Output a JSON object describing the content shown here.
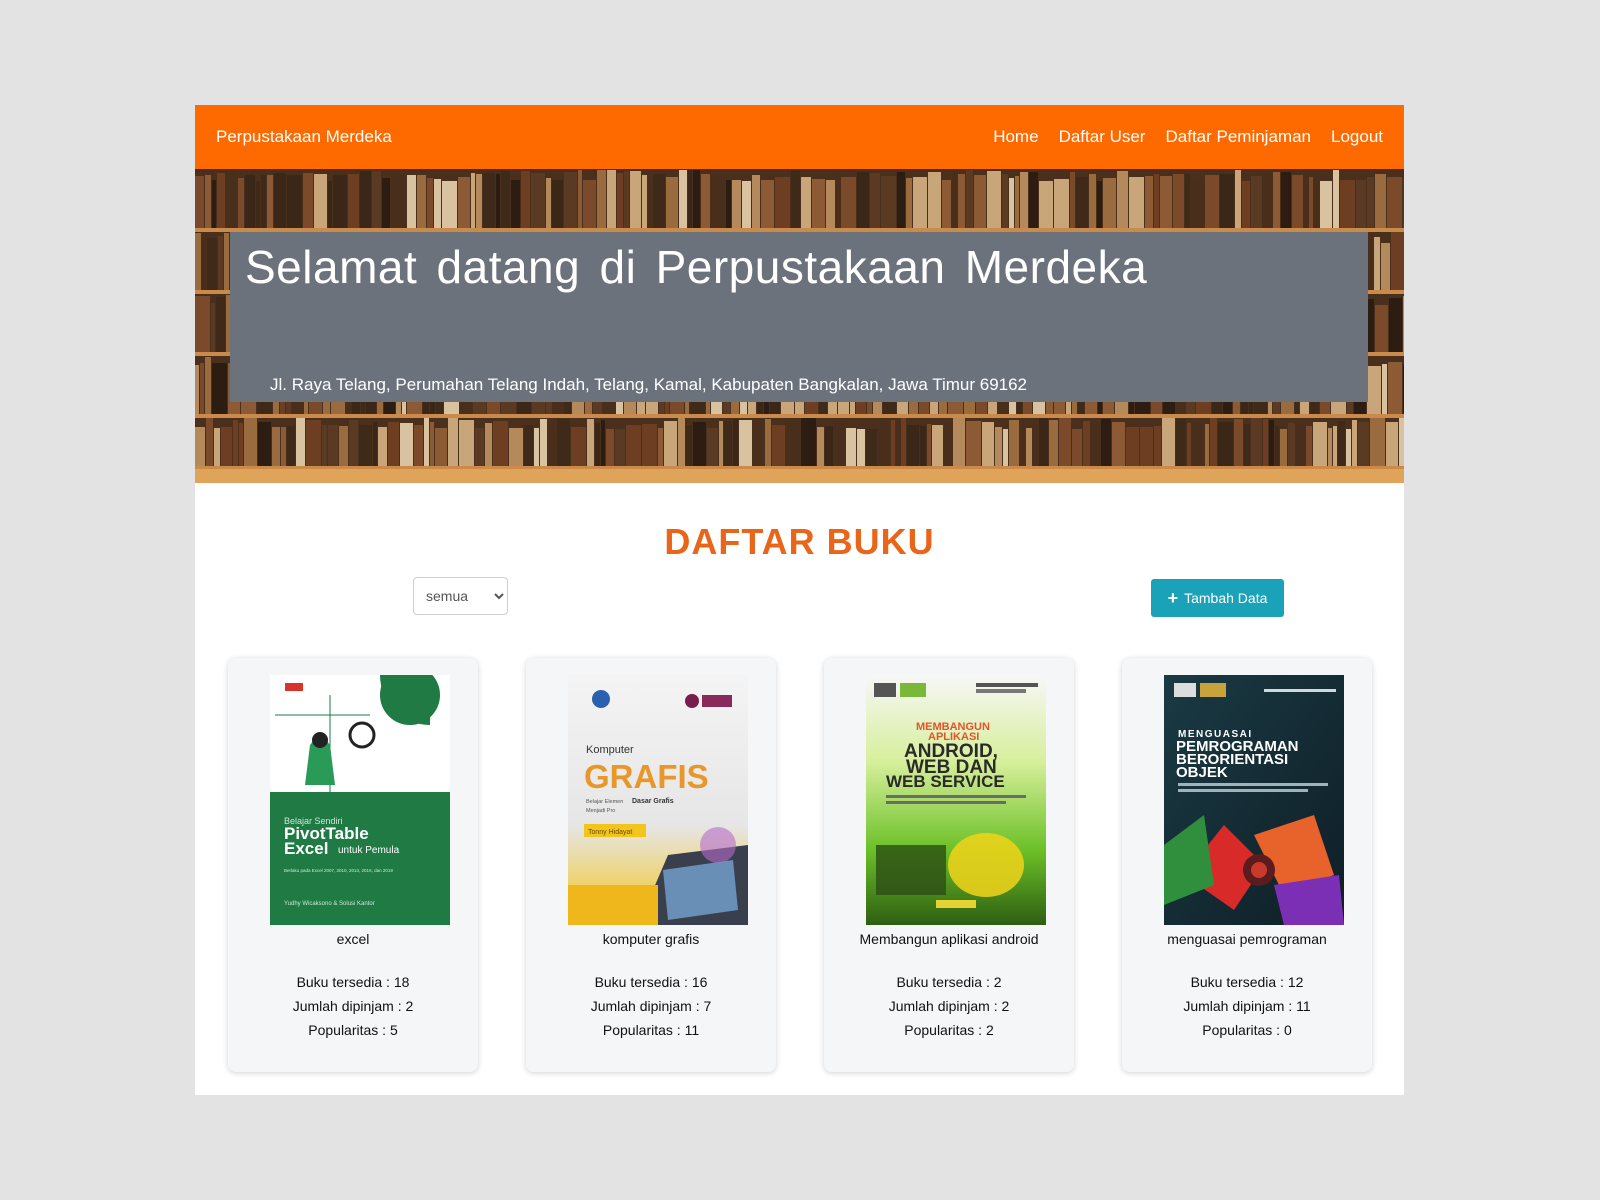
{
  "navbar": {
    "brand": "Perpustakaan Merdeka",
    "links": [
      "Home",
      "Daftar User",
      "Daftar Peminjaman",
      "Logout"
    ]
  },
  "hero": {
    "title": "Selamat datang di Perpustakaan Merdeka",
    "address": "Jl. Raya Telang, Perumahan Telang Indah, Telang, Kamal, Kabupaten Bangkalan, Jawa Timur 69162"
  },
  "main": {
    "title": "DAFTAR BUKU",
    "filter": {
      "selected": "semua"
    },
    "add_button": "Tambah Data"
  },
  "books": [
    {
      "title": "excel",
      "available": "Buku tersedia : 18",
      "borrowed": "Jumlah dipinjam : 2",
      "popularity": "Popularitas : 5",
      "cover": {
        "line1": "Belajar Sendiri",
        "line2": "PivotTable",
        "line3": "Excel",
        "line3b": "untuk Pemula",
        "line4": "Berlaku pada Excel 2007, 2010, 2013, 2016, dan 2019",
        "author": "Yudhy Wicaksono & Solusi Kantor"
      }
    },
    {
      "title": "komputer grafis",
      "available": "Buku tersedia : 16",
      "borrowed": "Jumlah dipinjam : 7",
      "popularity": "Popularitas : 11",
      "cover": {
        "line1": "Komputer",
        "line2": "GRAFIS",
        "line3": "Belajar Elemen",
        "line3b": "Dasar Grafis",
        "line4": "Menjadi Pro",
        "author": "Tonny Hidayat"
      }
    },
    {
      "title": "Membangun aplikasi android",
      "available": "Buku tersedia : 2",
      "borrowed": "Jumlah dipinjam : 2",
      "popularity": "Popularitas : 2",
      "cover": {
        "line1": "MEMBANGUN",
        "line2": "APLIKASI",
        "line3": "ANDROID,",
        "line4": "WEB DAN",
        "line5": "WEB SERVICE"
      }
    },
    {
      "title": "menguasai pemrograman",
      "available": "Buku tersedia : 12",
      "borrowed": "Jumlah dipinjam : 11",
      "popularity": "Popularitas : 0",
      "cover": {
        "line1": "MENGUASAI",
        "line2": "PEMROGRAMAN",
        "line3": "BERORIENTASI",
        "line4": "OBJEK"
      }
    }
  ]
}
